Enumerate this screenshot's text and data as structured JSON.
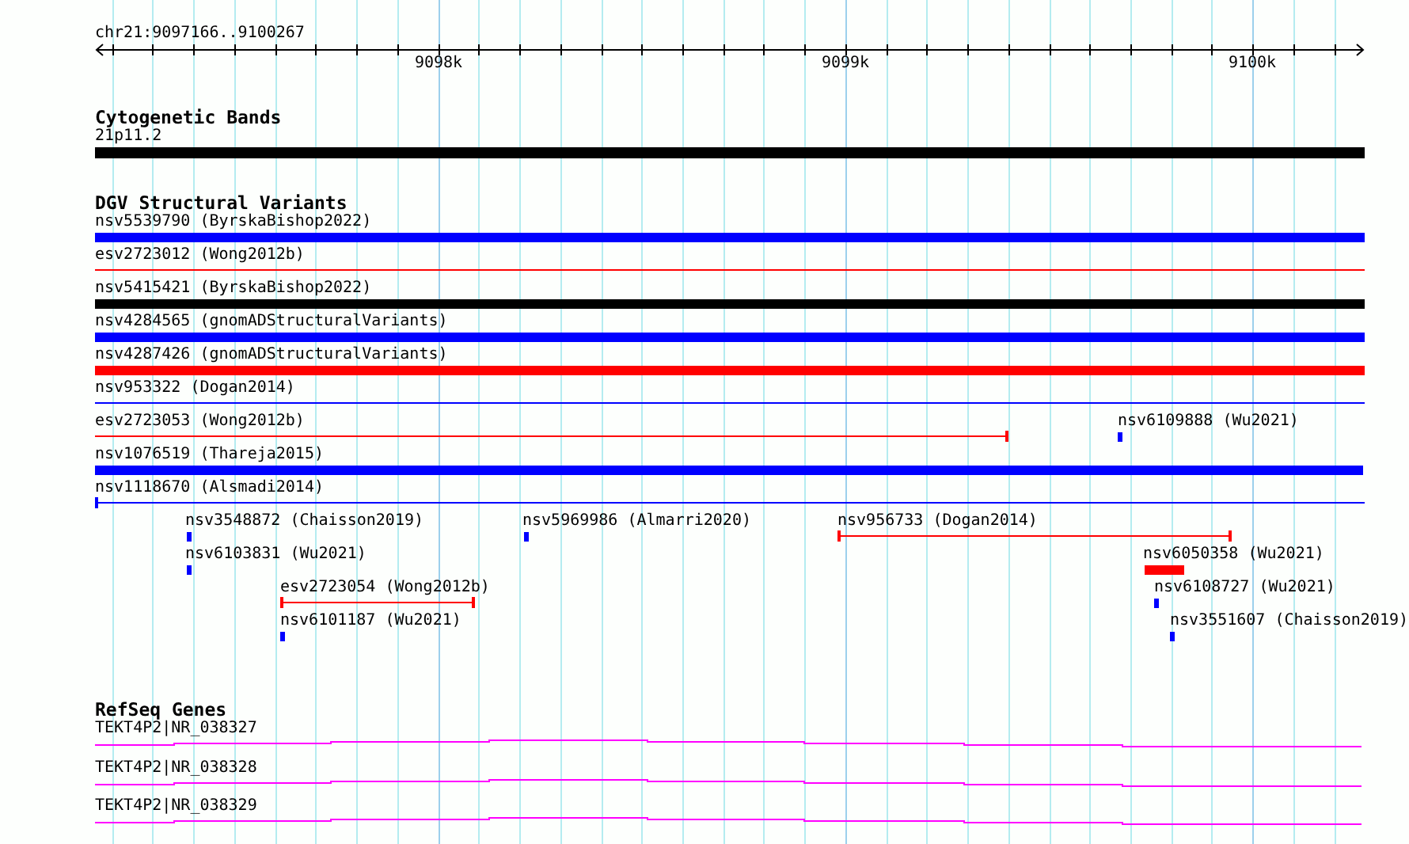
{
  "ruler": {
    "location": "chr21:9097166..9100267",
    "ticks": [
      "9098k",
      "9099k",
      "9100k"
    ]
  },
  "tracks": [
    {
      "title": "Cytogenetic Bands",
      "features": [
        {
          "label": "21p11.2",
          "kind": "band",
          "color": "#000000"
        }
      ]
    },
    {
      "title": "DGV Structural Variants",
      "features": [
        {
          "label": "nsv5539790 (ByrskaBishop2022)",
          "kind": "bar",
          "color": "#0000ff"
        },
        {
          "label": "esv2723012 (Wong2012b)",
          "kind": "line",
          "color": "#ff0000"
        },
        {
          "label": "nsv5415421 (ByrskaBishop2022)",
          "kind": "bar",
          "color": "#000000"
        },
        {
          "label": "nsv4284565 (gnomADStructuralVariants)",
          "kind": "bar",
          "color": "#0000ff"
        },
        {
          "label": "nsv4287426 (gnomADStructuralVariants)",
          "kind": "bar",
          "color": "#ff0000"
        },
        {
          "label": "nsv953322 (Dogan2014)",
          "kind": "line",
          "color": "#0000ff"
        },
        {
          "label": "esv2723053 (Wong2012b)",
          "kind": "line",
          "color": "#ff0000"
        },
        {
          "label": "nsv6109888 (Wu2021)",
          "kind": "bar",
          "color": "#0000ff"
        },
        {
          "label": "nsv1076519 (Thareja2015)",
          "kind": "bar",
          "color": "#0000ff"
        },
        {
          "label": "nsv1118670 (Alsmadi2014)",
          "kind": "line",
          "color": "#0000ff"
        },
        {
          "label": "nsv3548872 (Chaisson2019)",
          "kind": "bar",
          "color": "#0000ff"
        },
        {
          "label": "nsv5969986 (Almarri2020)",
          "kind": "bar",
          "color": "#0000ff"
        },
        {
          "label": "nsv956733 (Dogan2014)",
          "kind": "line",
          "color": "#ff0000"
        },
        {
          "label": "nsv6103831 (Wu2021)",
          "kind": "bar",
          "color": "#0000ff"
        },
        {
          "label": "nsv6050358 (Wu2021)",
          "kind": "bar",
          "color": "#ff0000"
        },
        {
          "label": "esv2723054 (Wong2012b)",
          "kind": "line",
          "color": "#ff0000"
        },
        {
          "label": "nsv6108727 (Wu2021)",
          "kind": "bar",
          "color": "#0000ff"
        },
        {
          "label": "nsv6101187 (Wu2021)",
          "kind": "bar",
          "color": "#0000ff"
        },
        {
          "label": "nsv3551607 (Chaisson2019)",
          "kind": "bar",
          "color": "#0000ff"
        }
      ]
    },
    {
      "title": "RefSeq Genes",
      "features": [
        {
          "label": "TEKT4P2|NR_038327",
          "kind": "gene",
          "color": "#ff00ff"
        },
        {
          "label": "TEKT4P2|NR_038328",
          "kind": "gene",
          "color": "#ff00ff"
        },
        {
          "label": "TEKT4P2|NR_038329",
          "kind": "gene",
          "color": "#ff00ff"
        }
      ]
    }
  ]
}
